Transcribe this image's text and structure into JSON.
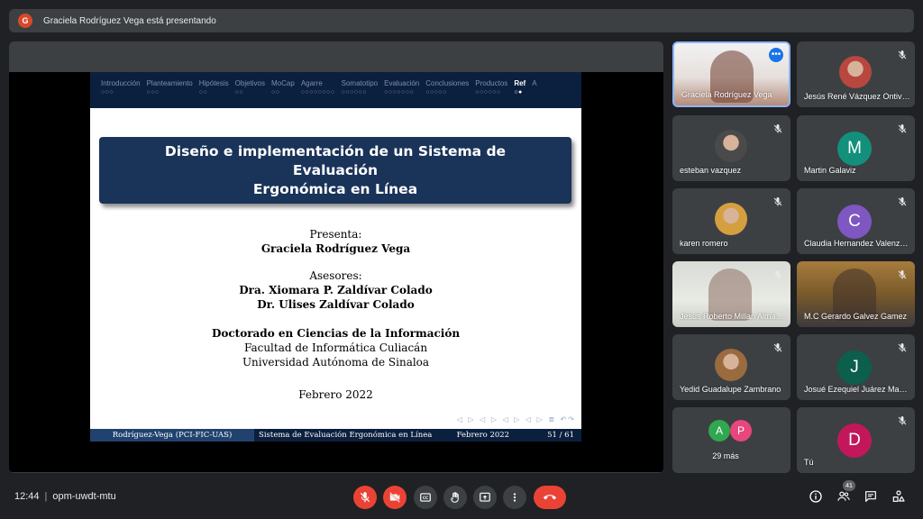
{
  "presenting": {
    "avatar_letter": "G",
    "text": "Graciela Rodríguez Vega está presentando"
  },
  "slide": {
    "nav": [
      {
        "label": "Introducción",
        "dots": "○○○",
        "active": false
      },
      {
        "label": "Planteamiento",
        "dots": "○○○",
        "active": false
      },
      {
        "label": "Hipótesis",
        "dots": "○○",
        "active": false
      },
      {
        "label": "Objetivos",
        "dots": "○○",
        "active": false
      },
      {
        "label": "MoCap",
        "dots": "○○",
        "active": false
      },
      {
        "label": "Agarre",
        "dots": "○○○○○○○○",
        "active": false
      },
      {
        "label": "Somatotipo",
        "dots": "○○○○○○",
        "active": false
      },
      {
        "label": "Evaluación",
        "dots": "○○○○○○○",
        "active": false
      },
      {
        "label": "Conclusiones",
        "dots": "○○○○○",
        "active": false
      },
      {
        "label": "Productos",
        "dots": "○○○○○○",
        "active": false
      },
      {
        "label": "Ref",
        "dots": "○●",
        "active": true
      },
      {
        "label": "A",
        "dots": "",
        "active": false
      }
    ],
    "title_line1": "Diseño e implementación de un Sistema de Evaluación",
    "title_line2": "Ergonómica en Línea",
    "presenta_label": "Presenta:",
    "presenter_name": "Graciela Rodríguez Vega",
    "asesores_label": "Asesores:",
    "advisor1": "Dra. Xiomara P. Zaldívar Colado",
    "advisor2": "Dr. Ulises Zaldívar Colado",
    "program": "Doctorado en Ciencias de la Información",
    "faculty": "Facultad de Informática Culiacán",
    "university": "Universidad Autónoma de Sinaloa",
    "date": "Febrero 2022",
    "beamer_icons": "◁ ▷ ◁ ▷ ◁ ▷ ◁ ▷ ≣ ↶↷",
    "footer_author": "Rodríguez-Vega  (PCI-FIC-UAS)",
    "footer_title": "Sistema de Evaluación Ergonómica en Línea",
    "footer_date": "Febrero 2022",
    "footer_page": "51 / 61"
  },
  "participants": [
    {
      "name": "Graciela Rodríguez Vega",
      "type": "video"
    },
    {
      "name": "Jesús René Vázquez Ontiveros",
      "type": "photo"
    },
    {
      "name": "esteban vazquez",
      "type": "photo"
    },
    {
      "name": "Martin Galaviz",
      "type": "letter",
      "letter": "M",
      "color": "#12907b"
    },
    {
      "name": "karen romero",
      "type": "photo"
    },
    {
      "name": "Claudia Hernandez Valenzuela",
      "type": "letter",
      "letter": "C",
      "color": "#7e57c2"
    },
    {
      "name": "Jesus Roberto Millan Almaraz",
      "type": "video"
    },
    {
      "name": "M.C Gerardo Galvez Gamez",
      "type": "video"
    },
    {
      "name": "Yedid Guadalupe Zambrano",
      "type": "photo"
    },
    {
      "name": "Josué Ezequiel Juárez Manjarrez",
      "type": "letter",
      "letter": "J",
      "color": "#0b5f4c"
    },
    {
      "name": "29 más",
      "type": "group",
      "letters": [
        "A",
        "P"
      ],
      "colors": [
        "#2fa84f",
        "#e8467c"
      ]
    },
    {
      "name": "Tú",
      "type": "letter",
      "letter": "D",
      "color": "#c2185b"
    }
  ],
  "bottom": {
    "time": "12:44",
    "separator": "|",
    "meeting_code": "opm-uwdt-mtu",
    "participants_count": "41"
  },
  "colors": {
    "background": "#202124",
    "tile": "#3c4043",
    "danger": "#ea4335",
    "accent": "#8ab4f8"
  }
}
